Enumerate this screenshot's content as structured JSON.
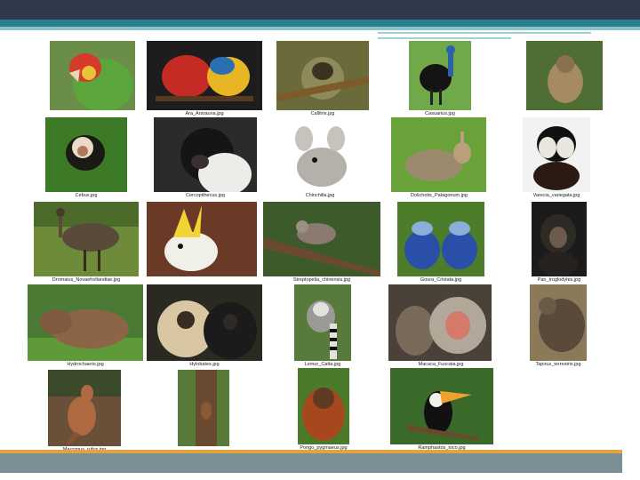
{
  "captions": {
    "ara": "Ara_Ararauna.jpg",
    "callitrix": "Callitrix.jpg",
    "casuarius": "Casuarius.jpg",
    "cebus": "Cebus.jpg",
    "cercopithecus": "Cercopithecus.jpg",
    "chinchilla": "Chinchilla.jpg",
    "dolichotis": "Dolichotis_Patagonum.jpg",
    "varecia": "Varecia_variegata.jpg",
    "dromaius": "Dromaius_Novaehollandiae.jpg",
    "streptopelia": "Streptopelia_chinensis.jpg",
    "goura": "Goura_Cristata.jpg",
    "pan": "Pan_troglodytes.jpg",
    "hydrochaeris": "Hydrochaeris.jpg",
    "hylobates": "Hylobates.jpg",
    "lemur": "Lemur_Catta.jpg",
    "macaca": "Macaca_Fuscata.jpg",
    "tapirus": "Tapirus_terrestris.jpg",
    "macropus": "Macropus_rufus.jpg",
    "pongo": "Pongo_pygmaeus.jpg",
    "ramphastos": "Ramphastos_toco.jpg"
  }
}
